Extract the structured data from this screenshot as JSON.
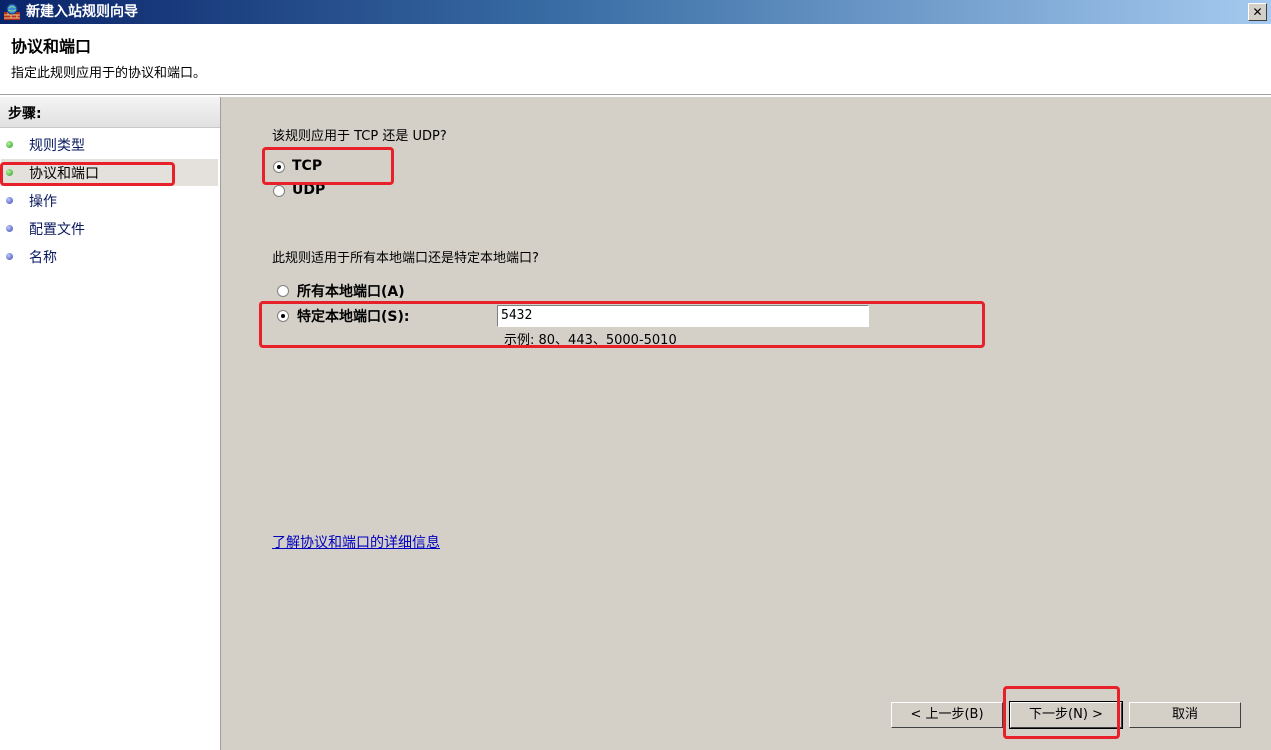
{
  "window": {
    "title": "新建入站规则向导",
    "close_glyph": "✕"
  },
  "header": {
    "title": "协议和端口",
    "subtitle": "指定此规则应用于的协议和端口。"
  },
  "steps": {
    "heading": "步骤:",
    "items": [
      {
        "label": "规则类型",
        "status": "done"
      },
      {
        "label": "协议和端口",
        "status": "current"
      },
      {
        "label": "操作",
        "status": "pending"
      },
      {
        "label": "配置文件",
        "status": "pending"
      },
      {
        "label": "名称",
        "status": "pending"
      }
    ]
  },
  "main": {
    "protocol_question": "该规则应用于 TCP 还是 UDP?",
    "protocol_options": [
      {
        "label": "TCP",
        "selected": true
      },
      {
        "label": "UDP",
        "selected": false
      }
    ],
    "port_question": "此规则适用于所有本地端口还是特定本地端口?",
    "port_options": [
      {
        "label": "所有本地端口(A)",
        "selected": false
      },
      {
        "label": "特定本地端口(S):",
        "selected": true
      }
    ],
    "port_value": "5432",
    "port_example": "示例: 80、443、5000-5010",
    "help_link": "了解协议和端口的详细信息"
  },
  "buttons": {
    "back": "< 上一步(B)",
    "next": "下一步(N) >",
    "cancel": "取消"
  },
  "colors": {
    "highlight": "#e8202a",
    "link": "#0000c0"
  }
}
